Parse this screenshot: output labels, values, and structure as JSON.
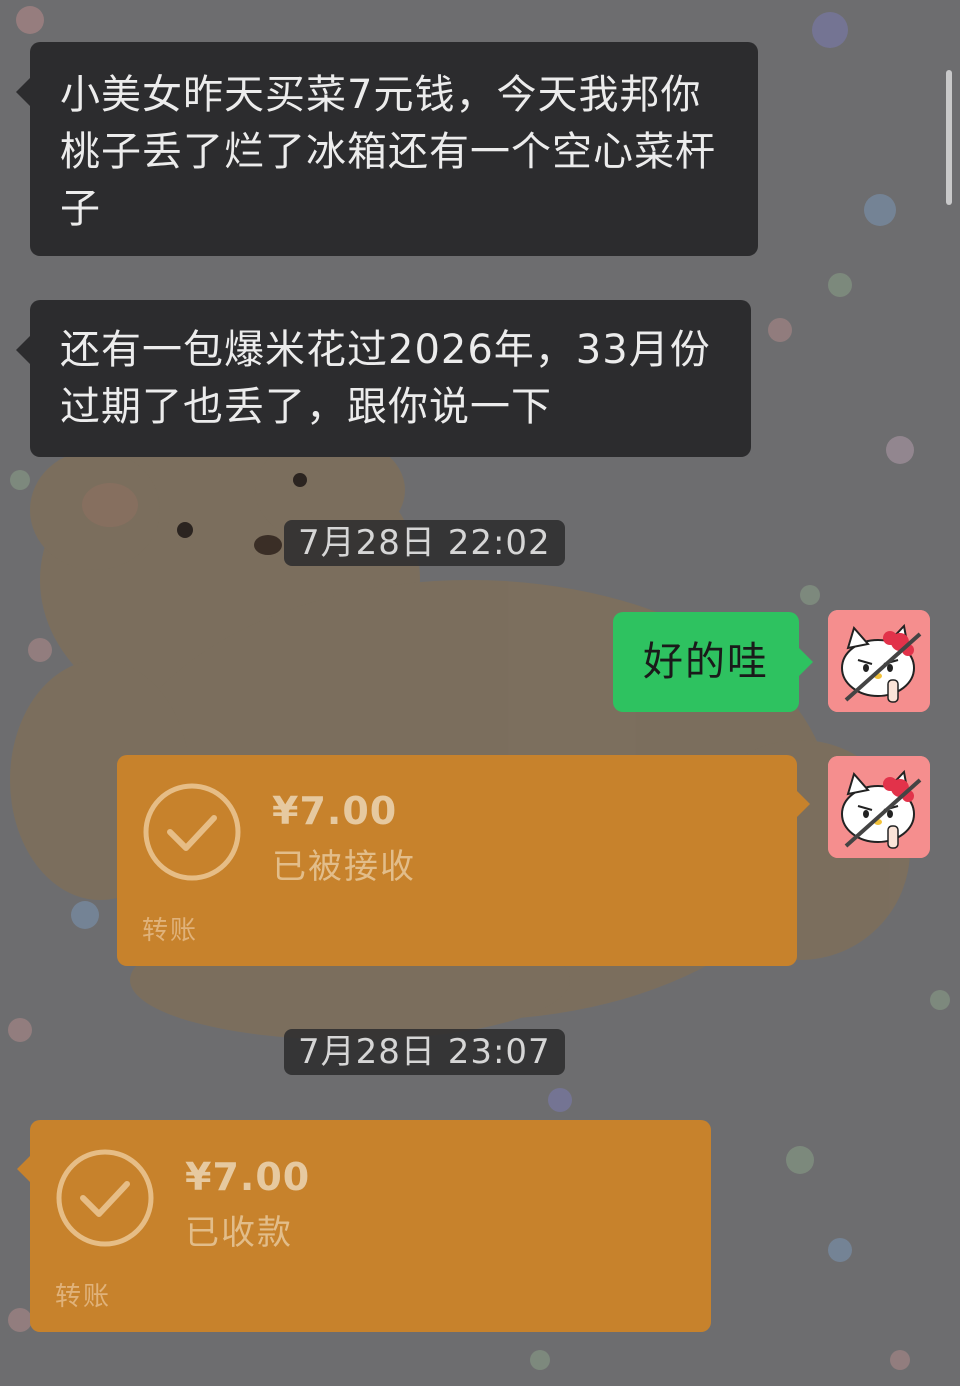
{
  "messages": [
    {
      "direction": "incoming",
      "lines": [
        "小美女昨天买菜7元钱，今天我邦你",
        "桃子丢了烂了冰箱还有一个空心菜杆",
        "子"
      ]
    },
    {
      "direction": "incoming",
      "lines": [
        "还有一包爆米花过2026年，33月份",
        "过期了也丢了，跟你说一下"
      ]
    },
    {
      "type": "timestamp",
      "text": "7月28日 22:02"
    },
    {
      "direction": "outgoing",
      "text": "好的哇",
      "avatar": "hello-kitty-avatar"
    },
    {
      "direction": "outgoing",
      "type": "transfer",
      "amount": "¥7.00",
      "status": "已被接收",
      "label": "转账",
      "avatar": "hello-kitty-avatar"
    },
    {
      "type": "timestamp",
      "text": "7月28日 23:07"
    },
    {
      "direction": "incoming",
      "type": "transfer",
      "amount": "¥7.00",
      "status": "已收款",
      "label": "转账"
    }
  ],
  "colors": {
    "incoming_bubble": "#2c2c2e",
    "outgoing_bubble": "#2ec260",
    "transfer_card": "#c7822c",
    "timestamp_bg": "#2d2d2f"
  }
}
